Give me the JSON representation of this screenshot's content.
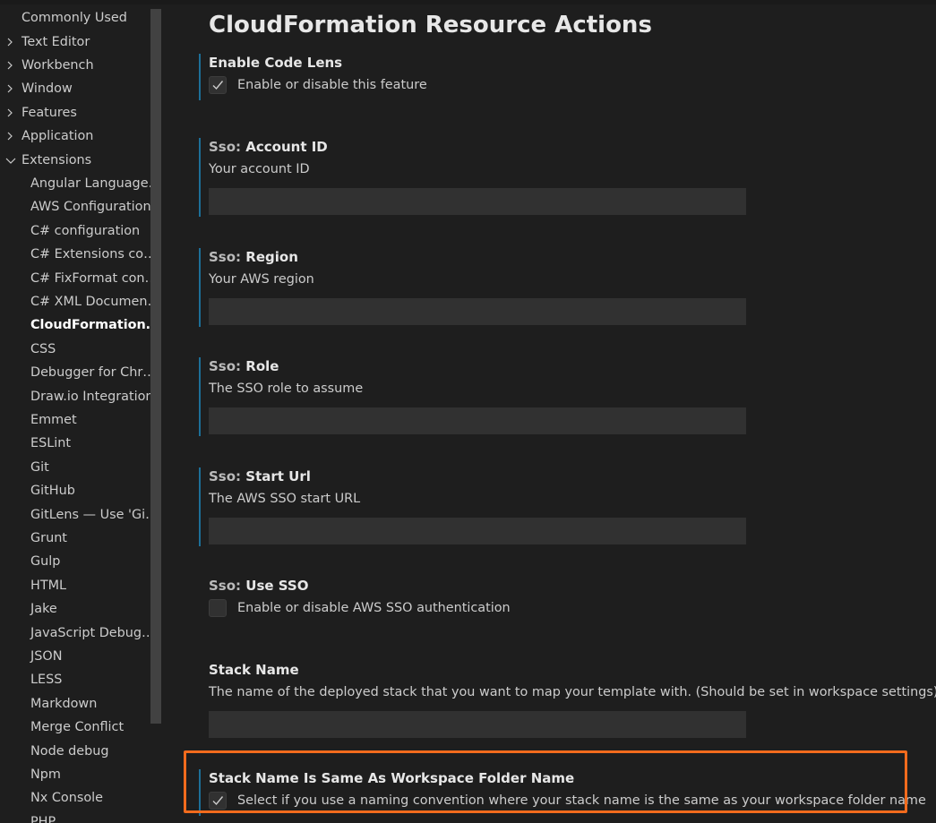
{
  "sidebar": {
    "items": [
      {
        "label": "Commonly Used",
        "expandable": false
      },
      {
        "label": "Text Editor",
        "expandable": true,
        "expanded": false
      },
      {
        "label": "Workbench",
        "expandable": true,
        "expanded": false
      },
      {
        "label": "Window",
        "expandable": true,
        "expanded": false
      },
      {
        "label": "Features",
        "expandable": true,
        "expanded": false
      },
      {
        "label": "Application",
        "expandable": true,
        "expanded": false
      },
      {
        "label": "Extensions",
        "expandable": true,
        "expanded": true
      }
    ],
    "extensions": [
      "Angular Language…",
      "AWS Configuration",
      "C# configuration",
      "C# Extensions con…",
      "C# FixFormat con…",
      "C# XML Documen…",
      "CloudFormation …",
      "CSS",
      "Debugger for Chr…",
      "Draw.io Integration",
      "Emmet",
      "ESLint",
      "Git",
      "GitHub",
      "GitLens — Use 'Git…",
      "Grunt",
      "Gulp",
      "HTML",
      "Jake",
      "JavaScript Debug…",
      "JSON",
      "LESS",
      "Markdown",
      "Merge Conflict",
      "Node debug",
      "Npm",
      "Nx Console",
      "PHP"
    ],
    "active_extension": "CloudFormation …"
  },
  "main": {
    "page_title": "CloudFormation Resource Actions",
    "settings": {
      "code_lens": {
        "title": "Enable Code Lens",
        "description": "Enable or disable this feature",
        "checked": true
      },
      "account_id": {
        "category": "Sso:",
        "title": "Account ID",
        "description": "Your account ID",
        "value": ""
      },
      "region": {
        "category": "Sso:",
        "title": "Region",
        "description": "Your AWS region",
        "value": ""
      },
      "role": {
        "category": "Sso:",
        "title": "Role",
        "description": "The SSO role to assume",
        "value": ""
      },
      "start_url": {
        "category": "Sso:",
        "title": "Start Url",
        "description": "The AWS SSO start URL",
        "value": ""
      },
      "use_sso": {
        "category": "Sso:",
        "title": "Use SSO",
        "description": "Enable or disable AWS SSO authentication",
        "checked": false
      },
      "stack_name": {
        "title": "Stack Name",
        "description": "The name of the deployed stack that you want to map your template with. (Should be set in workspace settings)",
        "value": ""
      },
      "stack_name_same": {
        "title": "Stack Name Is Same As Workspace Folder Name",
        "description": "Select if you use a naming convention where your stack name is the same as your workspace folder name",
        "checked": true
      }
    }
  },
  "colors": {
    "background": "#1e1e1e",
    "modified_indicator": "#1d6f98",
    "highlight_box": "#f26b1d",
    "input_background": "#313131"
  }
}
